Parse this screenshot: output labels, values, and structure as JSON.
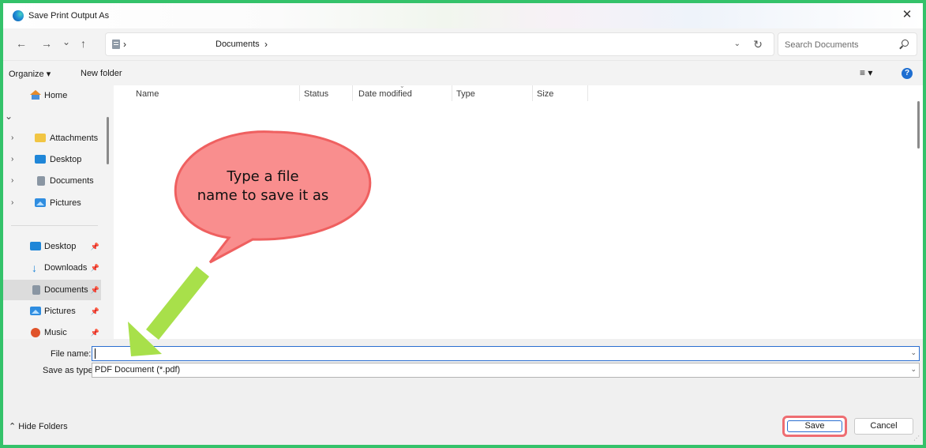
{
  "window": {
    "title": "Save Print Output As",
    "close_glyph": "✕"
  },
  "nav": {
    "back_glyph": "←",
    "forward_glyph": "→",
    "recent_glyph": "⌄",
    "up_glyph": "↑",
    "address_sep": "›",
    "address_location": "Documents",
    "address_location_sep": "›",
    "address_dropdown_glyph": "⌄",
    "refresh_glyph": "↻",
    "search_placeholder": "Search Documents"
  },
  "commands": {
    "organize_label": "Organize ▾",
    "new_folder_label": "New folder",
    "view_label": "≡ ▾",
    "help_label": "?"
  },
  "sidebar": {
    "home_label": "Home",
    "expand_glyph": "⌄",
    "tree_items": [
      {
        "label": "Attachments",
        "chevron": "›",
        "icon": "folder-icon"
      },
      {
        "label": "Desktop",
        "chevron": "›",
        "icon": "desktop-icon"
      },
      {
        "label": "Documents",
        "chevron": "›",
        "icon": "documents-icon"
      },
      {
        "label": "Pictures",
        "chevron": "›",
        "icon": "pictures-icon"
      }
    ],
    "quick_items": [
      {
        "label": "Desktop",
        "icon": "desktop-icon",
        "pin": "📌"
      },
      {
        "label": "Downloads",
        "icon": "download-icon",
        "pin": "📌"
      },
      {
        "label": "Documents",
        "icon": "documents-icon",
        "pin": "📌",
        "selected": true
      },
      {
        "label": "Pictures",
        "icon": "pictures-icon",
        "pin": "📌"
      },
      {
        "label": "Music",
        "icon": "music-icon",
        "pin": "📌"
      }
    ]
  },
  "columns": [
    "Name",
    "Status",
    "Date modified",
    "Type",
    "Size"
  ],
  "form": {
    "filename_label": "File name:",
    "filename_value": "",
    "savetype_label": "Save as type:",
    "savetype_value": "PDF Document (*.pdf)",
    "dropdown_glyph": "⌄"
  },
  "footer": {
    "hide_folders_label": "⌃  Hide Folders",
    "save_label": "Save",
    "cancel_label": "Cancel"
  },
  "annotation": {
    "callout_line1": "Type a file",
    "callout_line2": "name to save it as",
    "callout_color": "#f98e8e",
    "callout_border": "#ef6060",
    "arrow_color": "#a8e04a",
    "highlight_color": "#ee6d72"
  },
  "colors": {
    "frame_border": "#34c26a",
    "accent": "#2b6fd1"
  }
}
